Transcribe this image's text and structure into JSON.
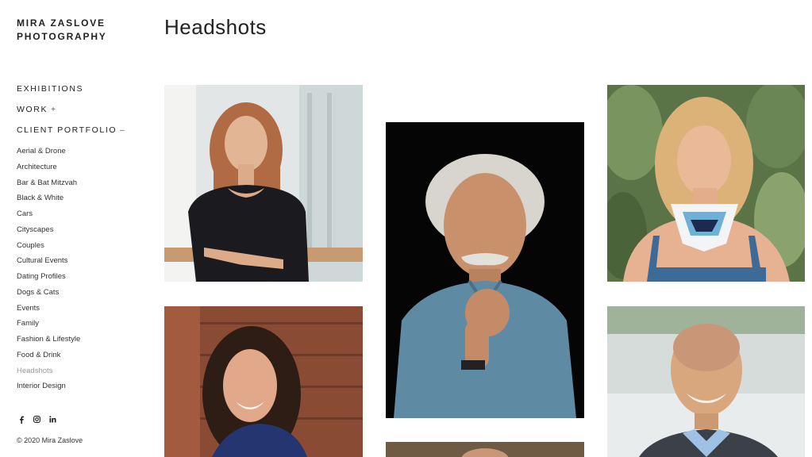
{
  "brand": {
    "line1": "MIRA ZASLOVE",
    "line2": "PHOTOGRAPHY"
  },
  "nav": {
    "exhibitions": "EXHIBITIONS",
    "work": "WORK",
    "work_symbol": "+",
    "client_portfolio": "CLIENT PORTFOLIO",
    "client_portfolio_symbol": "–"
  },
  "subnav": [
    "Aerial & Drone",
    "Architecture",
    "Bar & Bat Mitzvah",
    "Black & White",
    "Cars",
    "Cityscapes",
    "Couples",
    "Cultural Events",
    "Dating Profiles",
    "Dogs & Cats",
    "Events",
    "Family",
    "Fashion & Lifestyle",
    "Food & Drink",
    "Headshots",
    "Interior Design"
  ],
  "active_subnav": "Headshots",
  "social": [
    {
      "icon": "facebook-icon",
      "glyph": "f"
    },
    {
      "icon": "instagram-icon",
      "glyph": "◎"
    },
    {
      "icon": "linkedin-icon",
      "glyph": "in"
    }
  ],
  "footer": {
    "copyright": "© 2020 Mira Zaslove"
  },
  "page": {
    "title": "Headshots"
  },
  "gallery": [
    {
      "id": "woman-black-top",
      "bg": "#dfe3e3",
      "skin": "#e0b394",
      "hair": "#b26a45",
      "shirt": "#1b1b1f"
    },
    {
      "id": "older-man-mustache",
      "bg": "#060606",
      "skin": "#c7906c",
      "hair": "#d9d6d0",
      "shirt": "#5f8aa3"
    },
    {
      "id": "blonde-woman-scarf",
      "bg": "#5f7a4e",
      "skin": "#e9b796",
      "hair": "#dcb278",
      "shirt": "#3d6a96"
    },
    {
      "id": "woman-dark-hair-smiling",
      "bg": "#8a4b34",
      "skin": "#e1a889",
      "hair": "#2e1d15",
      "shirt": "#25356f"
    },
    {
      "id": "man-suit-smiling",
      "bg": "#d5dbd9",
      "skin": "#d9a77e",
      "hair": "#c99777",
      "shirt": "#3b4049"
    },
    {
      "id": "partial-headshot",
      "bg": "#6f5a44",
      "skin": "#c99777",
      "hair": "#3a2a1e",
      "shirt": "#3a2a1e"
    }
  ]
}
